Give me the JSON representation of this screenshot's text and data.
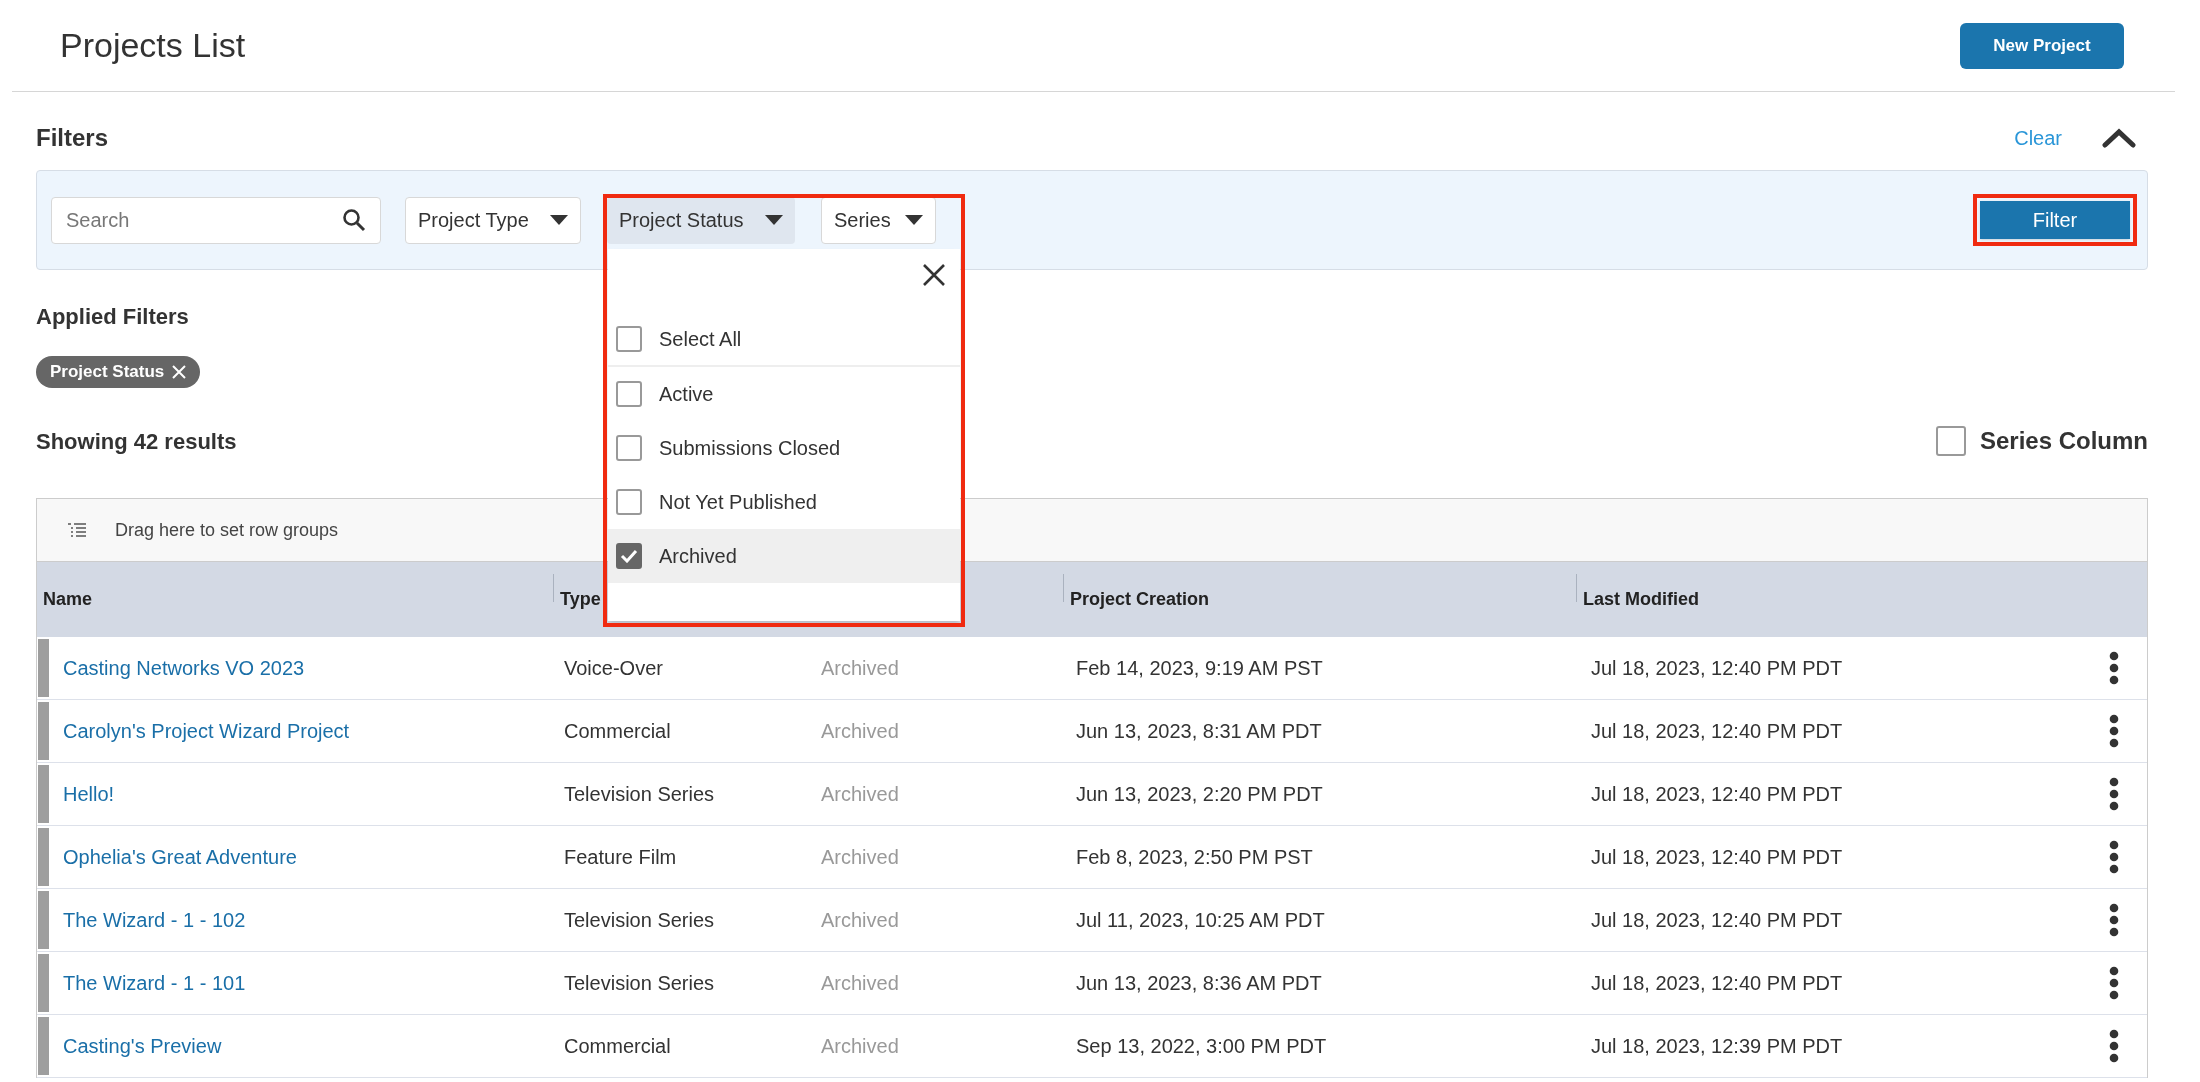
{
  "header": {
    "title": "Projects List",
    "new_button": "New Project"
  },
  "filters": {
    "title": "Filters",
    "clear": "Clear",
    "expanded": true,
    "search": {
      "placeholder": "Search"
    },
    "dropdowns": [
      {
        "label": "Project Type",
        "open": false,
        "highlighted": false
      },
      {
        "label": "Project Status",
        "open": true,
        "highlighted": true
      },
      {
        "label": "Series",
        "open": false,
        "highlighted": false
      }
    ],
    "menu_options": [
      {
        "label": "Select All",
        "checked": false,
        "hovered": false
      },
      {
        "label": "Active",
        "checked": false,
        "hovered": false
      },
      {
        "label": "Submissions Closed",
        "checked": false,
        "hovered": false
      },
      {
        "label": "Not Yet Published",
        "checked": false,
        "hovered": false
      },
      {
        "label": "Archived",
        "checked": true,
        "hovered": true
      }
    ],
    "filter_button": {
      "label": "Filter",
      "highlighted": true
    }
  },
  "applied_filters": {
    "title": "Applied Filters",
    "chips": [
      "Project Status"
    ]
  },
  "results": {
    "summary": "Showing 42 results",
    "series_column": {
      "label": "Series Column",
      "checked": false
    }
  },
  "table": {
    "group_hint": "Drag here to set row groups",
    "columns": [
      "Name",
      "Type",
      "Project Creation",
      "Last Modified"
    ],
    "rows": [
      {
        "name": "Casting Networks VO 2023",
        "type": "Voice-Over",
        "status": "Archived",
        "created": "Feb 14, 2023, 9:19 AM PST",
        "modified": "Jul 18, 2023, 12:40 PM PDT"
      },
      {
        "name": "Carolyn's Project Wizard Project",
        "type": "Commercial",
        "status": "Archived",
        "created": "Jun 13, 2023, 8:31 AM PDT",
        "modified": "Jul 18, 2023, 12:40 PM PDT"
      },
      {
        "name": "Hello!",
        "type": "Television Series",
        "status": "Archived",
        "created": "Jun 13, 2023, 2:20 PM PDT",
        "modified": "Jul 18, 2023, 12:40 PM PDT"
      },
      {
        "name": "Ophelia's Great Adventure",
        "type": "Feature Film",
        "status": "Archived",
        "created": "Feb 8, 2023, 2:50 PM PST",
        "modified": "Jul 18, 2023, 12:40 PM PDT"
      },
      {
        "name": "The Wizard - 1 - 102",
        "type": "Television Series",
        "status": "Archived",
        "created": "Jul 11, 2023, 10:25 AM PDT",
        "modified": "Jul 18, 2023, 12:40 PM PDT"
      },
      {
        "name": "The Wizard - 1 - 101",
        "type": "Television Series",
        "status": "Archived",
        "created": "Jun 13, 2023, 8:36 AM PDT",
        "modified": "Jul 18, 2023, 12:40 PM PDT"
      },
      {
        "name": "Casting's Preview",
        "type": "Commercial",
        "status": "Archived",
        "created": "Sep 13, 2022, 3:00 PM PDT",
        "modified": "Jul 18, 2023, 12:39 PM PDT"
      }
    ]
  }
}
